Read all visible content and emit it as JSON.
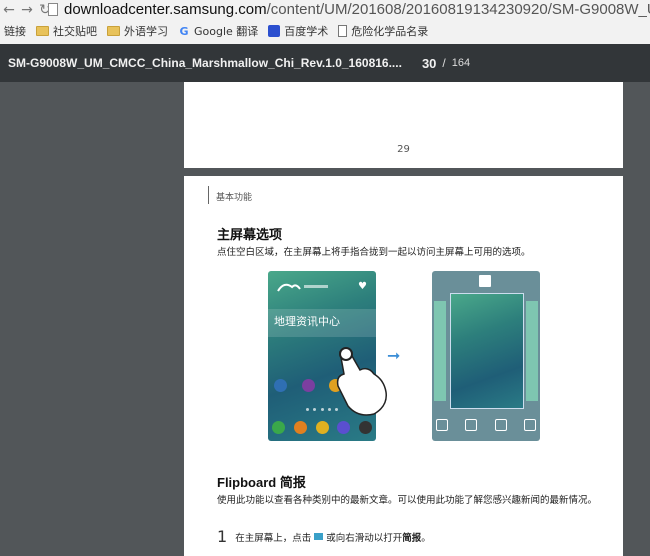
{
  "browser": {
    "url_host": "downloadcenter.samsung.com",
    "url_path": "/content/UM/201608/20160819134230920/SM-G9008W_U",
    "bookmarks": [
      {
        "label": "链接",
        "icon": "none"
      },
      {
        "label": "社交贴吧",
        "icon": "folder-icon"
      },
      {
        "label": "外语学习",
        "icon": "folder-icon"
      },
      {
        "label": "Google 翻译",
        "icon": "google-icon"
      },
      {
        "label": "百度学术",
        "icon": "baidu-paw-icon"
      },
      {
        "label": "危险化学品名录",
        "icon": "document-icon"
      }
    ]
  },
  "pdf_toolbar": {
    "title": "SM-G9008W_UM_CMCC_China_Marshmallow_Chi_Rev.1.0_160816....",
    "page_current": "30",
    "separator": "/",
    "page_total": "164"
  },
  "prev_page": {
    "number": "29"
  },
  "page": {
    "section": "基本功能",
    "heading1": "主屏幕选项",
    "para1": "点住空白区域，在主屏幕上将手指合拢到一起以访问主屏幕上可用的选项。",
    "phone_banner": "地理资讯中心",
    "heading2": "Flipboard 简报",
    "para2": "使用此功能以查看各种类别中的最新文章。可以使用此功能了解您感兴趣新闻的最新情况。",
    "step_num": "1",
    "step_text_a": "在主屏幕上，点击",
    "step_text_b": "或向右滑动以打开",
    "step_text_bold": "简报",
    "step_text_end": "。"
  },
  "colors": {
    "viewer_bg": "#525659",
    "toolbar_bg": "#323639",
    "arrow": "#3b8ed6"
  }
}
